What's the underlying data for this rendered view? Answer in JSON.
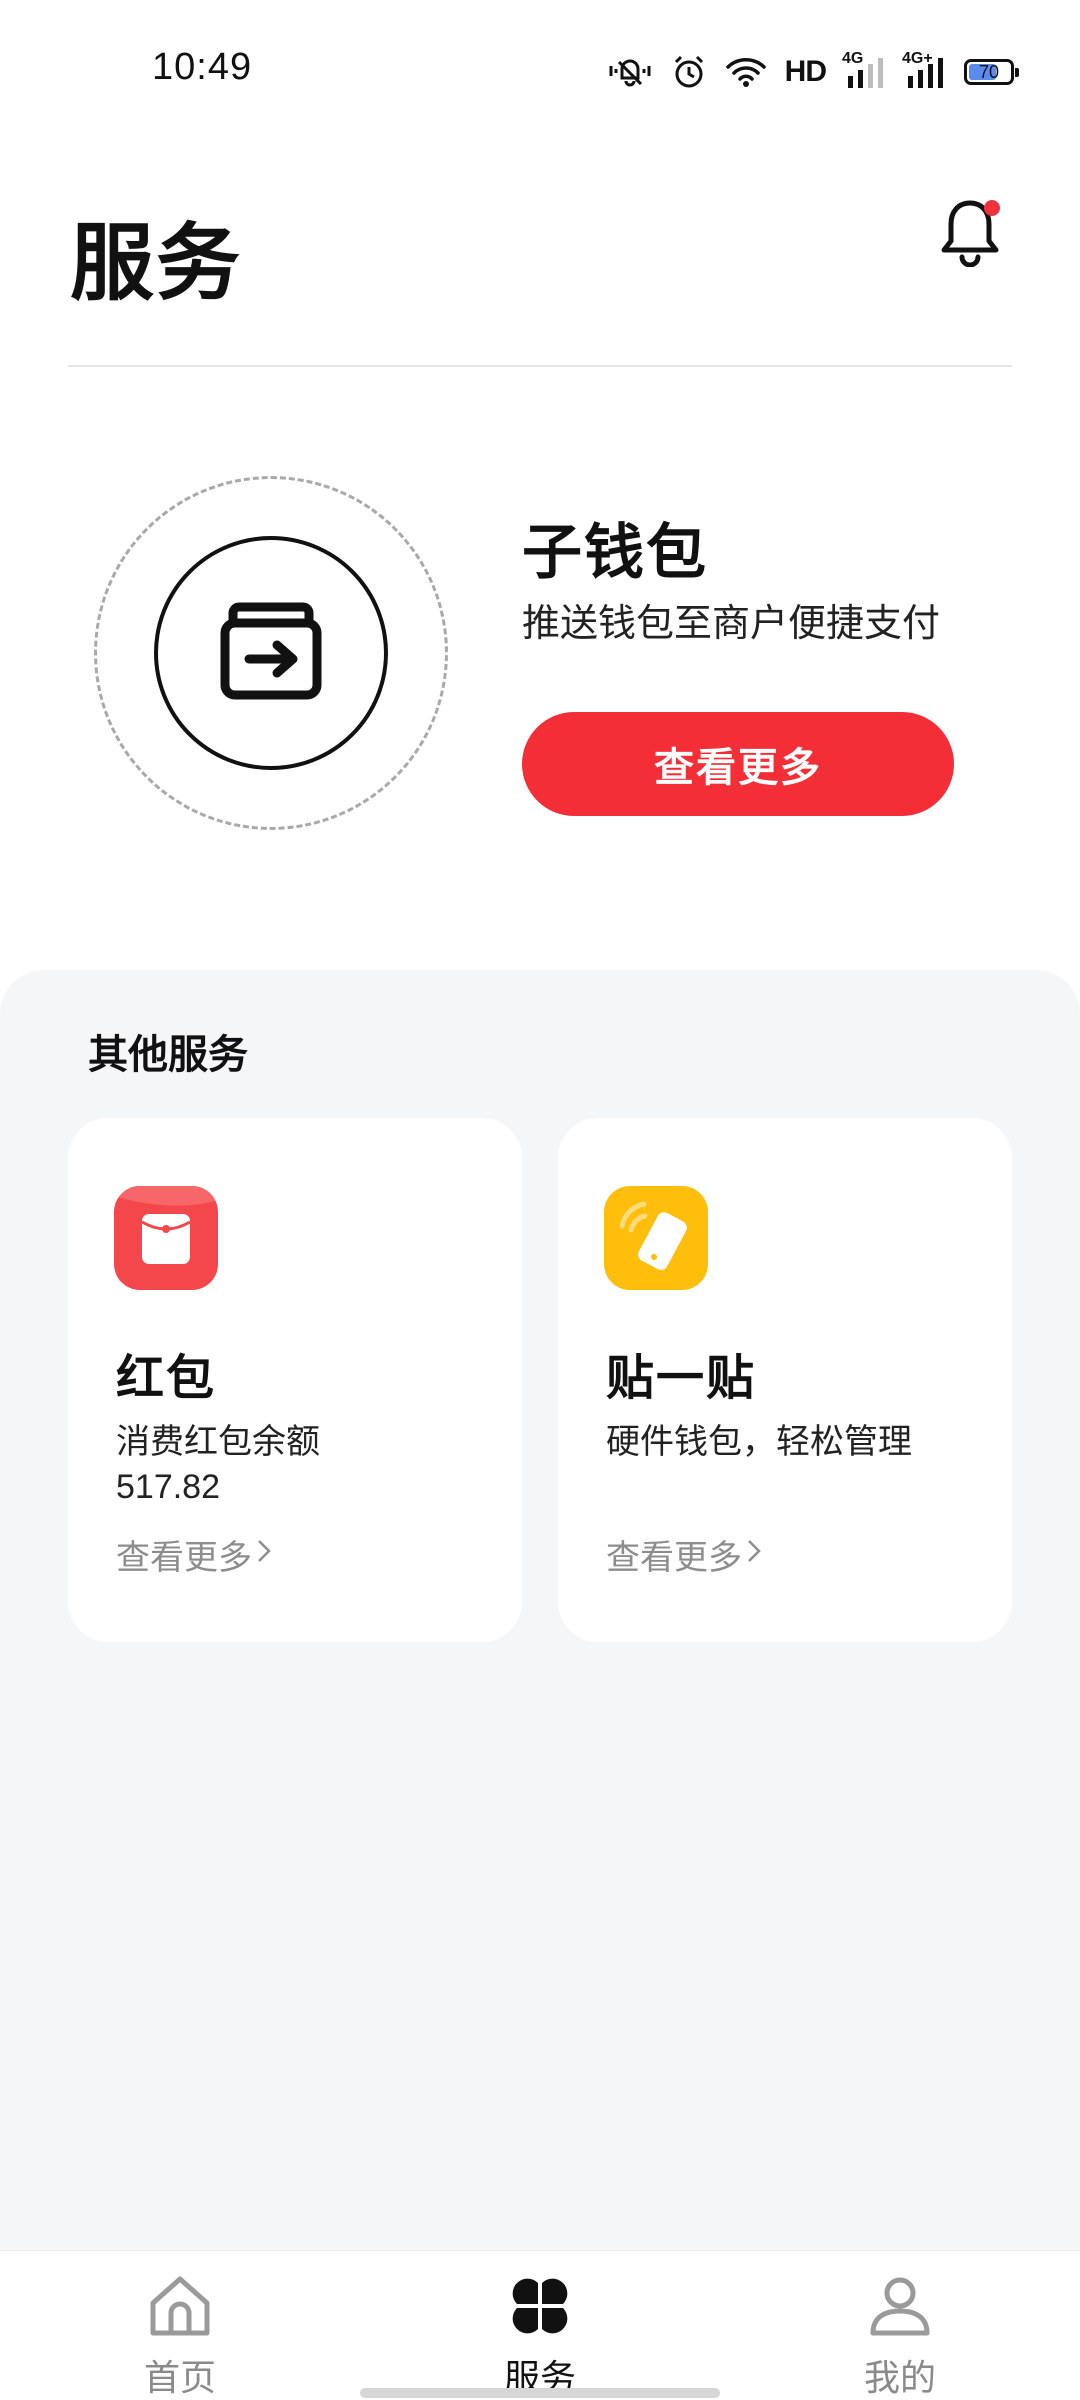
{
  "status_bar": {
    "time": "10:49",
    "hd_label": "HD",
    "network_1": "4G",
    "network_2": "4G+",
    "battery_level": "70",
    "battery_fraction": 0.7,
    "icons": [
      "mute-vibrate-icon",
      "alarm-icon",
      "wifi-icon",
      "signal-icon",
      "signal-icon",
      "battery-icon"
    ]
  },
  "header": {
    "title": "服务",
    "notification_icon": "bell-icon",
    "has_unread": true
  },
  "hero": {
    "icon": "wallet-transfer-icon",
    "title": "子钱包",
    "subtitle": "推送钱包至商户便捷支付",
    "button_label": "查看更多",
    "button_color": "#f32e37"
  },
  "other_services": {
    "title": "其他服务",
    "cards": [
      {
        "icon": "red-packet-icon",
        "icon_color": "#f3474c",
        "title": "红包",
        "description": "消费红包余额",
        "value": "517.82",
        "link_label": "查看更多"
      },
      {
        "icon": "tap-phone-icon",
        "icon_color": "#ffbe0b",
        "title": "贴一贴",
        "description": "硬件钱包，轻松管理",
        "link_label": "查看更多"
      }
    ]
  },
  "bottom_nav": {
    "items": [
      {
        "label": "首页",
        "icon": "home-icon",
        "active": false
      },
      {
        "label": "服务",
        "icon": "services-grid-icon",
        "active": true
      },
      {
        "label": "我的",
        "icon": "profile-icon",
        "active": false
      }
    ]
  }
}
